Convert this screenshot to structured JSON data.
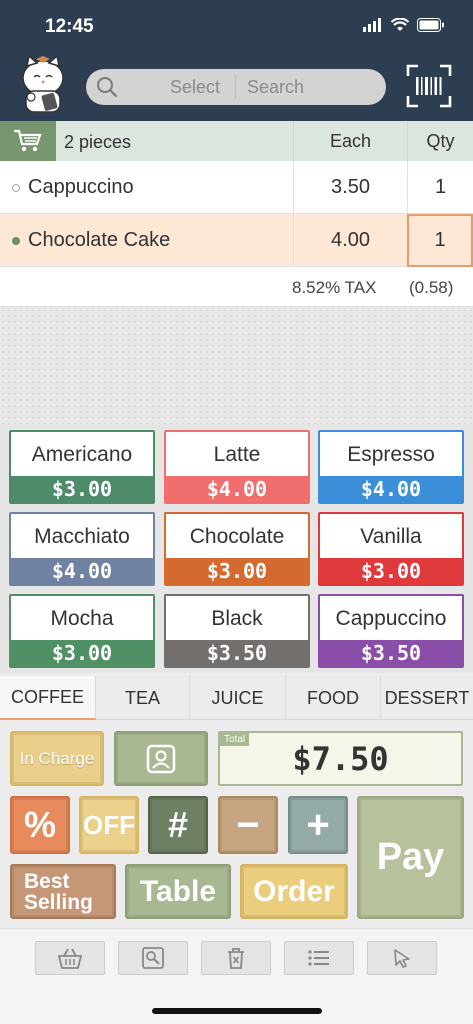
{
  "status_bar": {
    "time": "12:45"
  },
  "search": {
    "select_label": "Select",
    "search_label": "Search"
  },
  "cart": {
    "pieces": "2 pieces",
    "col_each": "Each",
    "col_qty": "Qty",
    "items": [
      {
        "name": "Cappuccino",
        "each": "3.50",
        "qty": "1"
      },
      {
        "name": "Chocolate Cake",
        "each": "4.00",
        "qty": "1"
      }
    ],
    "tax_label": "8.52% TAX",
    "tax_value": "(0.58)"
  },
  "products": [
    {
      "name": "Americano",
      "price": "$3.00",
      "color": "#4e8b6a"
    },
    {
      "name": "Latte",
      "price": "$4.00",
      "color": "#f06e6e"
    },
    {
      "name": "Espresso",
      "price": "$4.00",
      "color": "#3a8fd8"
    },
    {
      "name": "Macchiato",
      "price": "$4.00",
      "color": "#6f82a2"
    },
    {
      "name": "Chocolate",
      "price": "$3.00",
      "color": "#d56a2f"
    },
    {
      "name": "Vanilla",
      "price": "$3.00",
      "color": "#e0393c"
    },
    {
      "name": "Mocha",
      "price": "$3.00",
      "color": "#4f9064"
    },
    {
      "name": "Black",
      "price": "$3.50",
      "color": "#736f6d"
    },
    {
      "name": "Cappuccino",
      "price": "$3.50",
      "color": "#8a4ea8"
    }
  ],
  "tabs": [
    "COFFEE",
    "TEA",
    "JUICE",
    "FOOD",
    "DESSERT"
  ],
  "controls": {
    "in_charge": "In Charge",
    "total_tag": "Total",
    "total_value": "$7.50",
    "percent": "%",
    "off": "OFF",
    "hash": "#",
    "minus": "−",
    "plus": "+",
    "pay": "Pay",
    "best_selling_1": "Best",
    "best_selling_2": "Selling",
    "table": "Table",
    "order": "Order"
  },
  "toolbar_icons": [
    "basket-icon",
    "search-image-icon",
    "trash-icon",
    "list-icon",
    "pointer-icon"
  ]
}
